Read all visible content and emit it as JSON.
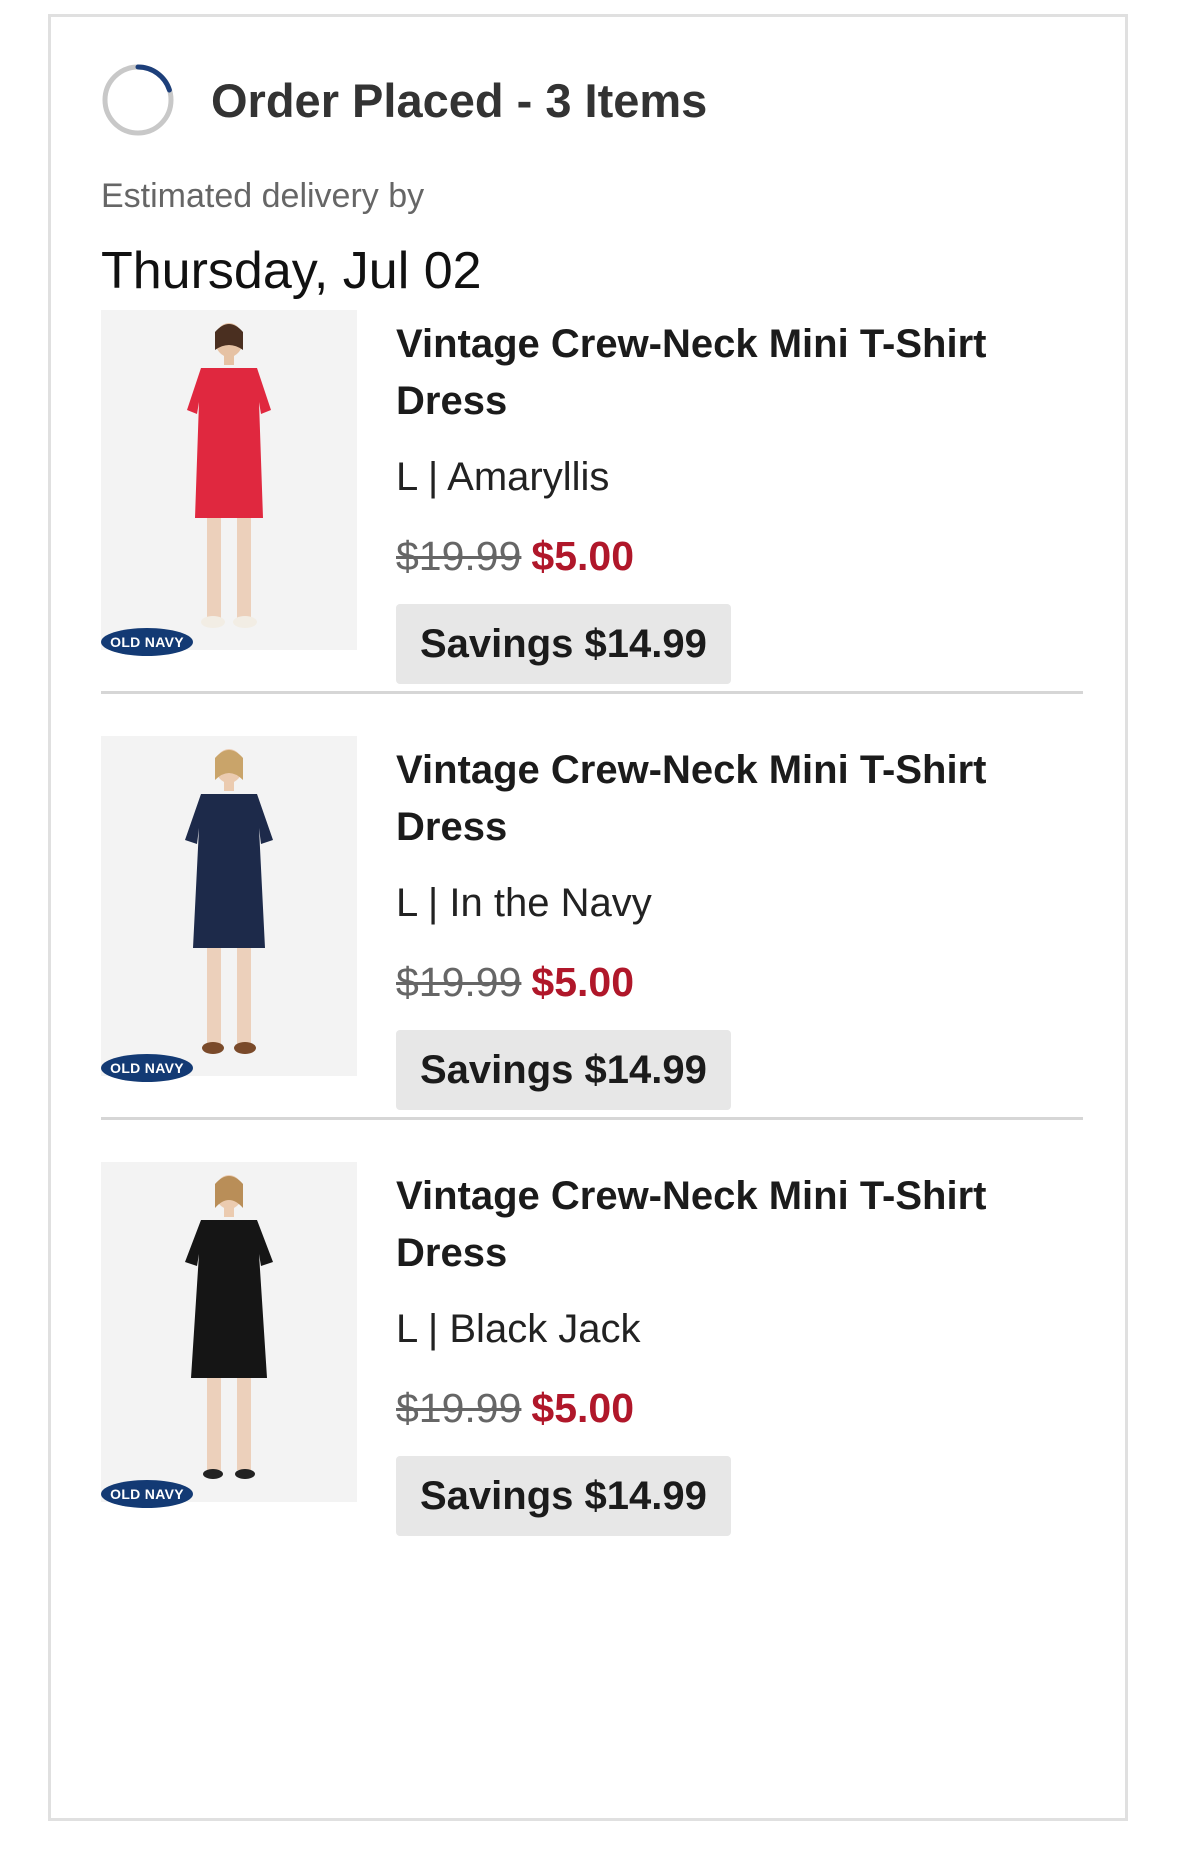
{
  "order": {
    "status_title": "Order Placed - 3 Items",
    "delivery_label": "Estimated delivery by",
    "delivery_date": "Thursday, Jul 02"
  },
  "items": [
    {
      "name": "Vintage Crew-Neck Mini T-Shirt Dress",
      "variant": "L | Amaryllis",
      "original_price": "$19.99",
      "sale_price": "$5.00",
      "savings": "Savings $14.99",
      "brand_badge": "OLD NAVY",
      "dress_color": "#e0283f"
    },
    {
      "name": "Vintage Crew-Neck Mini T-Shirt Dress",
      "variant": "L | In the Navy",
      "original_price": "$19.99",
      "sale_price": "$5.00",
      "savings": "Savings $14.99",
      "brand_badge": "OLD NAVY",
      "dress_color": "#1d2a4a"
    },
    {
      "name": "Vintage Crew-Neck Mini T-Shirt Dress",
      "variant": "L | Black Jack",
      "original_price": "$19.99",
      "sale_price": "$5.00",
      "savings": "Savings $14.99",
      "brand_badge": "OLD NAVY",
      "dress_color": "#151515"
    }
  ],
  "colors": {
    "sale_price": "#b0172a",
    "status_ring_progress": "#1d3f7a",
    "status_ring_track": "#c8c8c8",
    "brand_badge": "#133a74"
  },
  "icons": {
    "status": "progress-ring-icon"
  }
}
